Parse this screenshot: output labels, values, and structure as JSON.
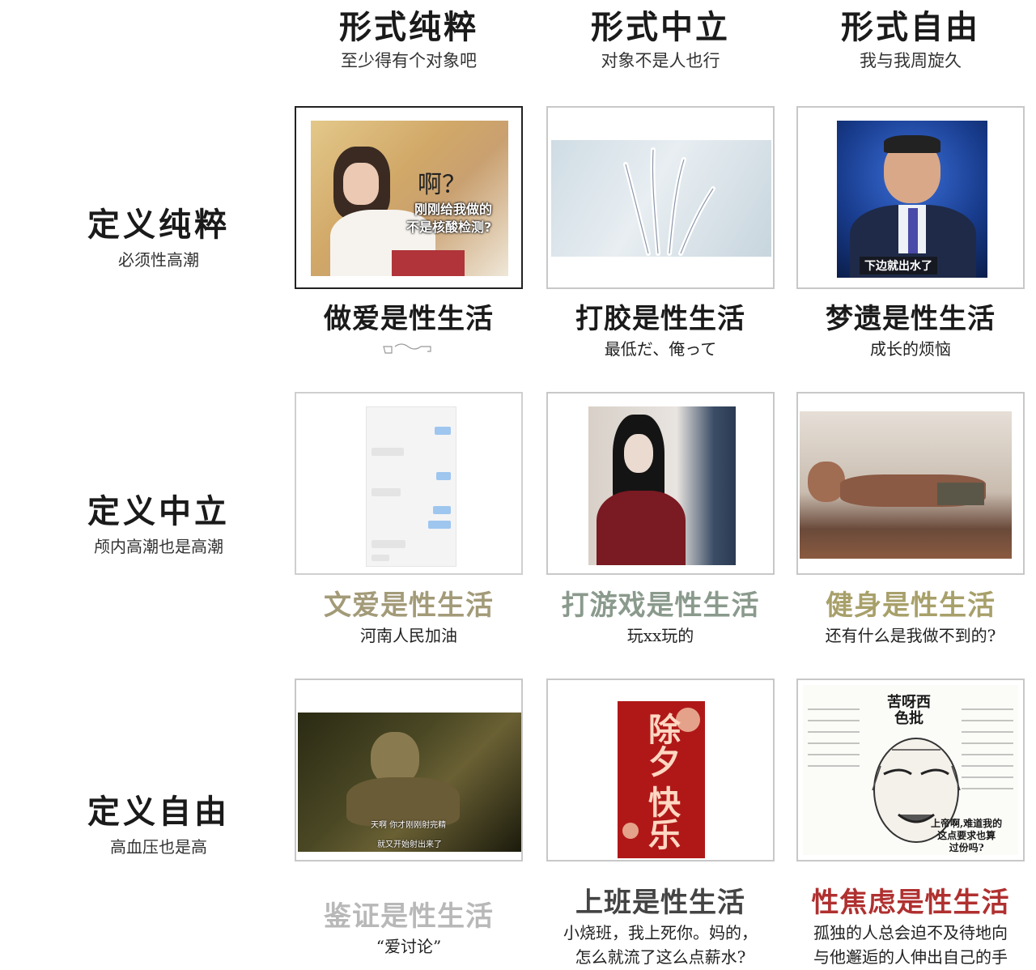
{
  "columns": [
    {
      "title": "形式纯粹",
      "subtitle": "至少得有个对象吧"
    },
    {
      "title": "形式中立",
      "subtitle": "对象不是人也行"
    },
    {
      "title": "形式自由",
      "subtitle": "我与我周旋久"
    }
  ],
  "rows": [
    {
      "title": "定义纯粹",
      "subtitle": "必须性高潮"
    },
    {
      "title": "定义中立",
      "subtitle": "颅内高潮也是高潮"
    },
    {
      "title": "定义自由",
      "subtitle": "高血压也是高"
    }
  ],
  "cells": [
    {
      "title": "做爱是性生活",
      "subtitle": "",
      "title_color": "#1a1a1a",
      "image_text": {
        "line1": "啊？",
        "line2": "刚刚给我做的",
        "line3": "不是核酸检测?"
      }
    },
    {
      "title": "打胶是性生活",
      "subtitle": "最低だ、俺って",
      "title_color": "#333333"
    },
    {
      "title": "梦遗是性生活",
      "subtitle": "成长的烦恼",
      "title_color": "#9a8aa6",
      "image_text": {
        "caption": "下边就出水了"
      }
    },
    {
      "title": "文爱是性生活",
      "subtitle": "河南人民加油",
      "title_color": "#a39a78"
    },
    {
      "title": "打游戏是性生活",
      "subtitle": "玩xx玩的",
      "title_color": "#8a9a8c"
    },
    {
      "title": "健身是性生活",
      "subtitle": "还有什么是我做不到的?",
      "title_color": "#a8a06a"
    },
    {
      "title": "鉴证是性生活",
      "subtitle": "“爱讨论”",
      "title_color": "#b8b8b8",
      "image_text": {
        "sub_cn": "天啊  你才刚刚射完精",
        "sub_cn2": "就又开始射出来了"
      }
    },
    {
      "title": "上班是性生活",
      "subtitle": "小烧班，我上死你。妈的，\n怎么就流了这么点薪水?",
      "title_color": "#444444",
      "image_text": {
        "line1": "除夕",
        "line2": "快乐"
      }
    },
    {
      "title": "性焦虑是性生活",
      "subtitle": "孤独的人总会迫不及待地向\n与他邂逅的人伸出自己的手",
      "title_color": "#b03030",
      "image_text": {
        "header": "苦呀西\n色批",
        "right_bottom": "上帝啊,难道我的\n这点要求也算\n过份吗?"
      }
    }
  ],
  "colors": {
    "frame_border": "#c8c8c8",
    "frame_border_dark": "#222222",
    "newyear_red": "#b01818"
  }
}
